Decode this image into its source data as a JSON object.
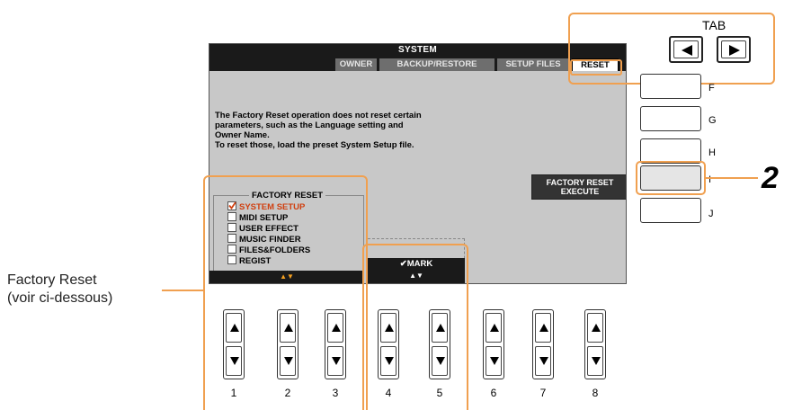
{
  "screen": {
    "title": "SYSTEM",
    "tabs": [
      "OWNER",
      "BACKUP/RESTORE",
      "SETUP FILES",
      "RESET"
    ],
    "active_tab": "RESET",
    "message": [
      "The Factory Reset operation does not reset certain",
      "parameters, such as the Language setting and",
      "Owner Name.",
      "To reset those, load the preset System Setup file."
    ],
    "factory_reset_title": "FACTORY RESET",
    "items": [
      {
        "label": "SYSTEM SETUP",
        "checked": true
      },
      {
        "label": "MIDI SETUP",
        "checked": false
      },
      {
        "label": "USER EFFECT",
        "checked": false
      },
      {
        "label": "MUSIC FINDER",
        "checked": false
      },
      {
        "label": "FILES&FOLDERS",
        "checked": false
      },
      {
        "label": "REGIST",
        "checked": false
      }
    ],
    "mark_label": "MARK",
    "execute_label_line1": "FACTORY RESET",
    "execute_label_line2": "EXECUTE"
  },
  "panel": {
    "tab_label": "TAB",
    "side_buttons": [
      "F",
      "G",
      "H",
      "I",
      "J"
    ],
    "bottom_buttons": [
      "1",
      "2",
      "3",
      "4",
      "5",
      "6",
      "7",
      "8"
    ]
  },
  "callouts": {
    "step_number": "2",
    "factory_reset_line1": "Factory Reset",
    "factory_reset_line2": "(voir ci-dessous)"
  },
  "colors": {
    "highlight": "#f0a050",
    "selected_item": "#d04010",
    "lcd_background": "#c8c8c8"
  }
}
